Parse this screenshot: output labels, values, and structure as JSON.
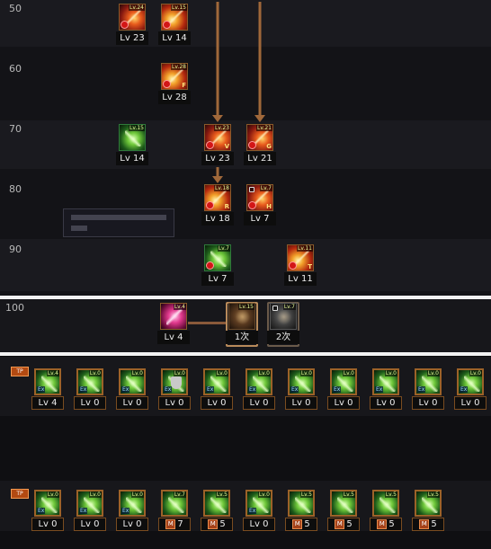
{
  "tree": {
    "levels": [
      {
        "label": "50"
      },
      {
        "label": "60"
      },
      {
        "label": "70"
      },
      {
        "label": "80"
      },
      {
        "label": "90"
      }
    ],
    "skills": [
      {
        "id": "s50a",
        "mini": "Lv.24",
        "letter": "",
        "style": "red",
        "lv": "Lv 23"
      },
      {
        "id": "s50b",
        "mini": "Lv.15",
        "letter": "",
        "style": "fire",
        "lv": "Lv 14"
      },
      {
        "id": "s60a",
        "mini": "Lv.28",
        "letter": "F",
        "style": "fire",
        "lv": "Lv 28"
      },
      {
        "id": "s70a",
        "mini": "Lv.15",
        "letter": "",
        "style": "green",
        "lv": "Lv 14"
      },
      {
        "id": "s70b",
        "mini": "Lv.23",
        "letter": "V",
        "style": "red",
        "lv": "Lv 23"
      },
      {
        "id": "s70c",
        "mini": "Lv.21",
        "letter": "G",
        "style": "red",
        "lv": "Lv 21"
      },
      {
        "id": "s80a",
        "mini": "Lv.18",
        "letter": "R",
        "style": "fire",
        "lv": "Lv 18"
      },
      {
        "id": "s80b",
        "mini": "Lv.7",
        "letter": "H",
        "style": "red",
        "lv": "Lv 7"
      },
      {
        "id": "s90a",
        "mini": "Lv.7",
        "letter": "",
        "style": "green",
        "lv": "Lv 7"
      },
      {
        "id": "s90b",
        "mini": "Lv.11",
        "letter": "T",
        "style": "fire",
        "lv": "Lv 11"
      }
    ]
  },
  "awakening": {
    "level_label": "100",
    "skills": [
      {
        "mini": "Lv.4",
        "style": "magenta",
        "lv": "Lv 4"
      },
      {
        "mini": "Lv.15",
        "style": "dark",
        "lv": "1次"
      },
      {
        "mini": "Lv.7",
        "style": "gray",
        "lv": "2次"
      }
    ]
  },
  "lower": {
    "row1_mark": "TP",
    "row2_mark": "TP",
    "row1": [
      {
        "mini": "Lv.4",
        "lv": "Lv 4"
      },
      {
        "mini": "Lv.0",
        "lv": "Lv 0"
      },
      {
        "mini": "Lv.0",
        "lv": "Lv 0"
      },
      {
        "mini": "Lv.0",
        "lv": "Lv 0"
      },
      {
        "mini": "Lv.0",
        "lv": "Lv 0"
      },
      {
        "mini": "Lv.0",
        "lv": "Lv 0"
      },
      {
        "mini": "Lv.0",
        "lv": "Lv 0"
      },
      {
        "mini": "Lv.0",
        "lv": "Lv 0"
      },
      {
        "mini": "Lv.0",
        "lv": "Lv 0"
      },
      {
        "mini": "Lv.0",
        "lv": "Lv 0"
      },
      {
        "mini": "Lv.0",
        "lv": "Lv 0"
      }
    ],
    "row2": [
      {
        "mini": "Lv.0",
        "lv": "Lv 0",
        "m": ""
      },
      {
        "mini": "Lv.0",
        "lv": "Lv 0",
        "m": ""
      },
      {
        "mini": "Lv.0",
        "lv": "Lv 0",
        "m": ""
      },
      {
        "mini": "Lv.7",
        "lv": "7",
        "m": "M"
      },
      {
        "mini": "Lv.5",
        "lv": "5",
        "m": "M"
      },
      {
        "mini": "Lv.0",
        "lv": "Lv 0",
        "m": ""
      },
      {
        "mini": "Lv.5",
        "lv": "5",
        "m": "M"
      },
      {
        "mini": "Lv.5",
        "lv": "5",
        "m": "M"
      },
      {
        "mini": "Lv.5",
        "lv": "5",
        "m": "M"
      },
      {
        "mini": "Lv.5",
        "lv": "5",
        "m": "M"
      }
    ]
  },
  "colors": {
    "arrow": "#a0683a",
    "connector": "#8a5a3a"
  }
}
